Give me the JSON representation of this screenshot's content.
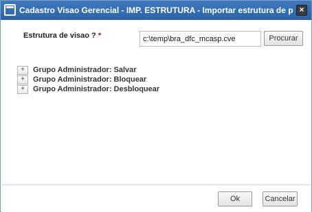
{
  "window": {
    "title": "Cadastro Visao Gerencial - IMP. ESTRUTURA - Importar estrutura de pla...",
    "close_label": "×",
    "app_icon": "window-icon"
  },
  "form": {
    "structure_label": "Estrutura de visao ?",
    "required_marker": "*",
    "structure_value": "c:\\temp\\bra_dfc_mcasp.cve",
    "browse_label": "Procurar"
  },
  "tree": {
    "expander_symbol": "+",
    "items": [
      {
        "label": "Grupo Administrador: Salvar"
      },
      {
        "label": "Grupo Administrador: Bloquear"
      },
      {
        "label": "Grupo Administrador: Desbloquear"
      }
    ]
  },
  "footer": {
    "ok_label": "Ok",
    "cancel_label": "Cancelar"
  },
  "colors": {
    "titlebar": "#2e64a8",
    "required": "#d0021b",
    "border": "#7a9cc2"
  }
}
